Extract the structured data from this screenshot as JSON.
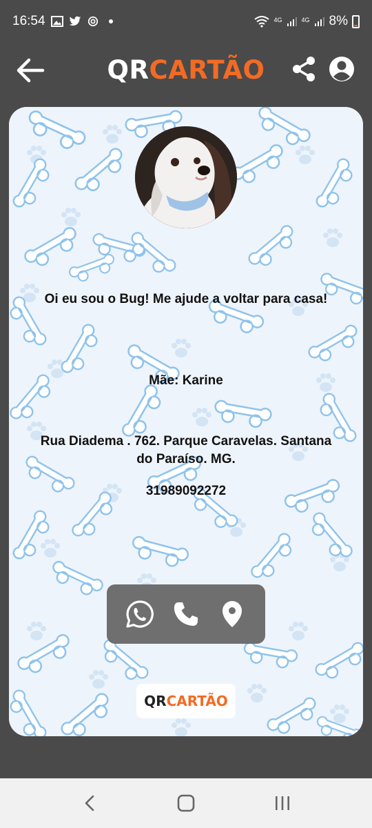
{
  "status_bar": {
    "time": "16:54",
    "signal_1_label": "4G",
    "signal_2_label": "4G",
    "battery": "8%",
    "icons": [
      "gallery-icon",
      "twitter-icon",
      "vpn-icon",
      "wifi-icon",
      "signal-icon",
      "battery-icon"
    ]
  },
  "header": {
    "brand_prefix": "QR",
    "brand_accent": "CARTÃO",
    "accent_color": "#f26b24"
  },
  "card": {
    "headline": "Oi eu sou o Bug! Me ajude a voltar para casa!",
    "owner": "Mãe: Karine",
    "address": "Rua Diadema . 762. Parque Caravelas. Santana do Paraíso. MG.",
    "phone": "31989092272",
    "actions": [
      "whatsapp-icon",
      "phone-icon",
      "location-pin-icon"
    ],
    "background_pattern": "dog-bones-and-paws"
  },
  "footer": {
    "brand_prefix": "QR",
    "brand_accent": "CARTÃO"
  },
  "system_nav": [
    "recent-apps",
    "home",
    "back"
  ]
}
